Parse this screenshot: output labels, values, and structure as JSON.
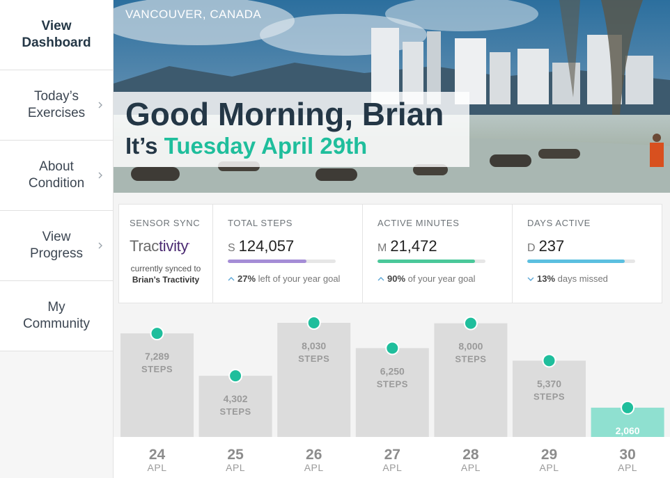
{
  "sidebar": {
    "items": [
      {
        "label": "View\nDashboard",
        "active": true,
        "chevron": false
      },
      {
        "label": "Today’s\nExercises",
        "active": false,
        "chevron": true
      },
      {
        "label": "About\nCondition",
        "active": false,
        "chevron": true
      },
      {
        "label": "View\nProgress",
        "active": false,
        "chevron": true
      },
      {
        "label": "My\nCommunity",
        "active": false,
        "chevron": false
      }
    ]
  },
  "hero": {
    "location": "VANCOUVER, CANADA",
    "greeting": "Good Morning, Brian",
    "date_prefix": "It’s",
    "date": "Tuesday April 29th"
  },
  "sensor": {
    "label": "SENSOR SYNC",
    "brand_part1": "Trac",
    "brand_part2": "tivity",
    "brand_mark": "•",
    "synced_text": "currently synced to",
    "synced_name": "Brian’s Tractivity"
  },
  "metrics": [
    {
      "label": "TOTAL STEPS",
      "prefix": "S",
      "value": "124,057",
      "progress": 0.73,
      "color": "#a58dd6",
      "arrow": "up",
      "note_bold": "27%",
      "note": "left of your year goal"
    },
    {
      "label": "ACTIVE MINUTES",
      "prefix": "M",
      "value": "21,472",
      "progress": 0.9,
      "color": "#4ac89a",
      "arrow": "up",
      "note_bold": "90%",
      "note": "of your year goal"
    },
    {
      "label": "DAYS ACTIVE",
      "prefix": "D",
      "value": "237",
      "progress": 0.9,
      "color": "#5bbfe0",
      "arrow": "down",
      "note_bold": "13%",
      "note": "days missed"
    }
  ],
  "chart_data": {
    "type": "bar",
    "categories": [
      "24",
      "25",
      "26",
      "27",
      "28",
      "29",
      "30"
    ],
    "category_sublabel": "APL",
    "unit_label": "STEPS",
    "values": [
      7289,
      4302,
      8030,
      6250,
      8000,
      5370,
      2060
    ],
    "value_labels": [
      "7,289",
      "4,302",
      "8,030",
      "6,250",
      "8,000",
      "5,370",
      "2,060"
    ],
    "highlight_index": 6,
    "colors": {
      "bar": "#dcdcdc",
      "highlight": "#8fe0d0",
      "dot": "#1fbe9c"
    }
  }
}
